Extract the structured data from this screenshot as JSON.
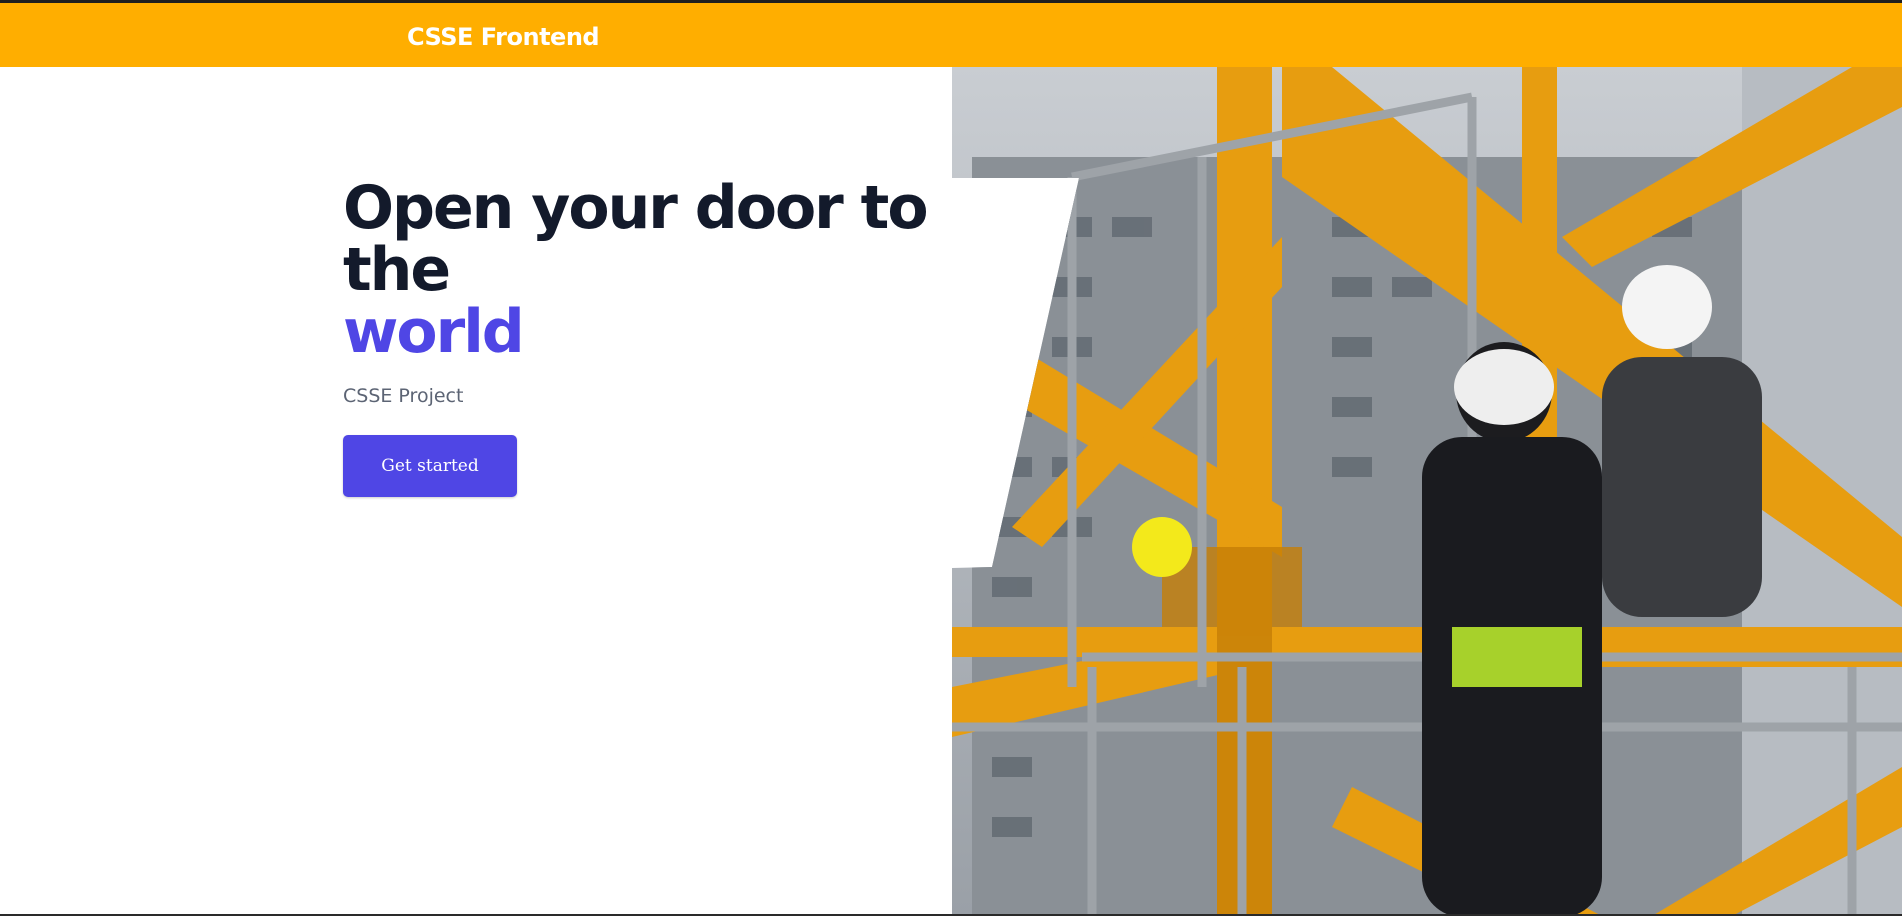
{
  "navbar": {
    "brand": "CSSE Frontend",
    "color": "#ffae00"
  },
  "hero": {
    "headline_line1": "Open your door to the",
    "headline_accent": "world",
    "subtitle": "CSSE Project",
    "cta_label": "Get started",
    "accent_color": "#4f46e5",
    "image_alt_semantic": "construction-crane-workers-photo"
  }
}
